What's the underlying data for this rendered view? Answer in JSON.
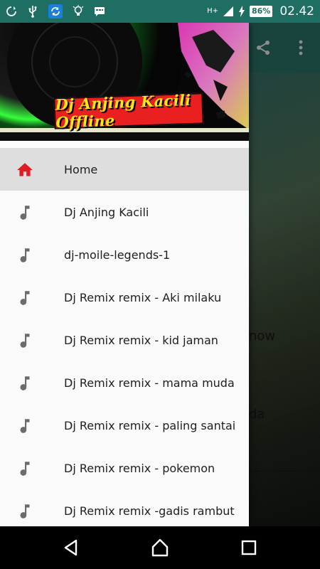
{
  "status_bar": {
    "battery": "86%",
    "time": "02.42",
    "network": "H+",
    "icons": [
      "sync-icon",
      "usb-icon",
      "sync-blue-icon",
      "bulb-icon",
      "chat-icon",
      "signal-icon",
      "charging-icon"
    ]
  },
  "background_app": {
    "visible_text_1": "now",
    "visible_text_2": "da",
    "actions": [
      "share-icon",
      "more-vert-icon"
    ]
  },
  "drawer": {
    "header_title": "Dj Anjing Kacili Offline",
    "items": [
      {
        "label": "Home",
        "icon": "home-icon",
        "active": true
      },
      {
        "label": "Dj Anjing Kacili",
        "icon": "music-note-icon",
        "active": false
      },
      {
        "label": "dj-moile-legends-1",
        "icon": "music-note-icon",
        "active": false
      },
      {
        "label": "Dj Remix remix - Aki milaku",
        "icon": "music-note-icon",
        "active": false
      },
      {
        "label": "Dj Remix remix - kid jaman",
        "icon": "music-note-icon",
        "active": false
      },
      {
        "label": "Dj Remix remix - mama muda",
        "icon": "music-note-icon",
        "active": false
      },
      {
        "label": "Dj Remix remix - paling santai",
        "icon": "music-note-icon",
        "active": false
      },
      {
        "label": "Dj Remix remix - pokemon",
        "icon": "music-note-icon",
        "active": false
      },
      {
        "label": "Dj Remix remix -gadis rambut",
        "icon": "music-note-icon",
        "active": false
      }
    ]
  },
  "nav_bar": {
    "buttons": [
      "back-icon",
      "home-nav-icon",
      "recents-icon"
    ]
  },
  "colors": {
    "status_bar": "#1e6e63",
    "home_icon": "#e01b24",
    "note_icon": "#6b6b6b",
    "active_row": "#dedede"
  }
}
